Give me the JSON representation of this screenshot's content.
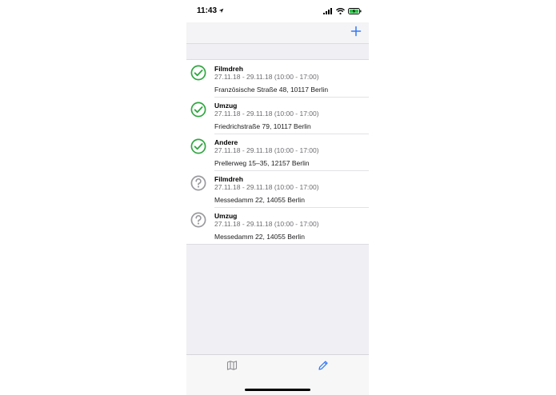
{
  "status_bar": {
    "time": "11:43",
    "icons": [
      "location-arrow-icon",
      "signal-icon",
      "wifi-icon",
      "battery-charging-icon"
    ]
  },
  "nav_bar": {
    "add_icon": "plus-icon",
    "accent_color": "#3478f6"
  },
  "entries": [
    {
      "status": "confirmed",
      "icon": "check-circle-icon",
      "title": "Filmdreh",
      "date": "27.11.18 - 29.11.18 (10:00 - 17:00)",
      "address": "Französische Straße 48, 10117 Berlin"
    },
    {
      "status": "confirmed",
      "icon": "check-circle-icon",
      "title": "Umzug",
      "date": "27.11.18 - 29.11.18 (10:00 - 17:00)",
      "address": "Friedrichstraße 79, 10117 Berlin"
    },
    {
      "status": "confirmed",
      "icon": "check-circle-icon",
      "title": "Andere",
      "date": "27.11.18 - 29.11.18 (10:00 - 17:00)",
      "address": "Prellerweg 15–35, 12157 Berlin"
    },
    {
      "status": "pending",
      "icon": "question-circle-icon",
      "title": "Filmdreh",
      "date": "27.11.18 - 29.11.18 (10:00 - 17:00)",
      "address": "Messedamm 22, 14055 Berlin"
    },
    {
      "status": "pending",
      "icon": "question-circle-icon",
      "title": "Umzug",
      "date": "27.11.18 - 29.11.18 (10:00 - 17:00)",
      "address": "Messedamm 22, 14055 Berlin"
    }
  ],
  "colors": {
    "confirmed": "#30a640",
    "pending": "#9a9a9e",
    "tab_inactive": "#8e8e93",
    "tab_active": "#3478f6"
  },
  "tab_bar": {
    "tabs": [
      {
        "icon": "map-icon",
        "active": false
      },
      {
        "icon": "pencil-icon",
        "active": true
      }
    ]
  }
}
